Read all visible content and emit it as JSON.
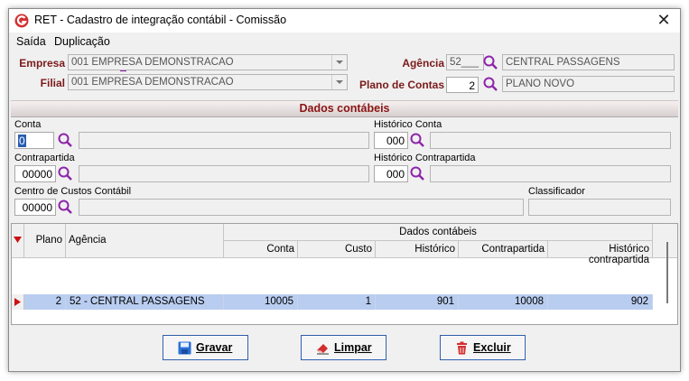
{
  "window": {
    "title": "RET - Cadastro de integração contábil - Comissão"
  },
  "menu": {
    "items": [
      "Saída",
      "Duplicação"
    ]
  },
  "header": {
    "empresa_label": "Empresa",
    "empresa_value": "001 EMPRESA DEMONSTRACAO",
    "filial_label": "Filial",
    "filial_value": "001 EMPRESA DEMONSTRACAO",
    "agencia_label": "Agência",
    "agencia_code": "52___",
    "agencia_name": "CENTRAL PASSAGENS",
    "plano_label": "Plano de Contas",
    "plano_code": "2",
    "plano_name": "PLANO NOVO"
  },
  "section": {
    "title": "Dados contábeis"
  },
  "form": {
    "conta_label": "Conta",
    "conta_value": "0",
    "conta_desc": "",
    "hist_conta_label": "Histórico Conta",
    "hist_conta_value": "000",
    "hist_conta_desc": "",
    "contrapartida_label": "Contrapartida",
    "contrapartida_value": "00000",
    "contrapartida_desc": "",
    "hist_contra_label": "Histórico Contrapartida",
    "hist_contra_value": "000",
    "hist_contra_desc": "",
    "centro_label": "Centro de Custos Contábil",
    "centro_value": "00000",
    "centro_desc": "",
    "classificador_label": "Classificador",
    "classificador_value": ""
  },
  "grid": {
    "group_header": "Dados contábeis",
    "columns": [
      "Plano",
      "Agência",
      "Conta",
      "Custo",
      "Histórico",
      "Contrapartida",
      "Histórico contrapartida"
    ],
    "rows": [
      {
        "plano": "2",
        "agencia": "52 - CENTRAL PASSAGENS",
        "conta": "10005",
        "custo": "1",
        "historico": "901",
        "contrapartida": "10008",
        "hist_contra": "902"
      }
    ]
  },
  "buttons": {
    "gravar": "Gravar",
    "limpar": "Limpar",
    "excluir": "Excluir"
  },
  "colors": {
    "accent": "#7a1a1a",
    "selection": "#b9cdf0",
    "magnifier": "#8e24aa"
  }
}
